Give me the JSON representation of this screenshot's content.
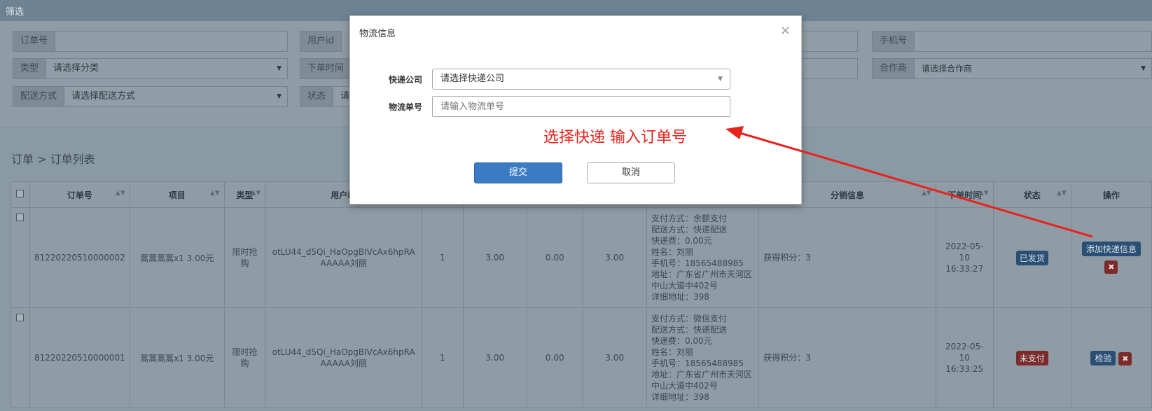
{
  "filter": {
    "title": "筛选",
    "order_no_label": "订单号",
    "user_id_label": "用户id",
    "phone_label": "手机号",
    "type_label": "类型",
    "type_value": "请选择分类",
    "order_time_label": "下单时间",
    "partner_label": "合作商",
    "partner_value": "请选择合作商",
    "delivery_label": "配送方式",
    "delivery_value": "请选择配送方式",
    "status_label": "状态",
    "status_value": "请"
  },
  "breadcrumb": "订单 > 订单列表",
  "table": {
    "headers": [
      "订单号",
      "项目",
      "类型",
      "用户id",
      "分销信息",
      "下单时间",
      "状态",
      "操作"
    ],
    "rows": [
      {
        "order_no": "81220220510000002",
        "item": "蒿蒿蒿蒿x1 3.00元",
        "type": "限时抢购",
        "user_id": "otLU44_d5Qi_HaOpgBIVcAx6hpRAAAAAA刘丽",
        "qty": "1",
        "price": "3.00",
        "discount": "0.00",
        "total": "3.00",
        "info": [
          "支付方式：余额支付",
          "配送方式：快递配送",
          "快递费：0.00元",
          "姓名：刘丽",
          "手机号：18565488985",
          "地址：广东省广州市天河区中山大道中402号",
          "详细地址：398"
        ],
        "dist": "获得积分：3",
        "time": "2022-05-10 16:33:27",
        "status": "已发货",
        "action": "添加快递信息"
      },
      {
        "order_no": "81220220510000001",
        "item": "蒿蒿蒿蒿x1 3.00元",
        "type": "限时抢购",
        "user_id": "otLU44_d5Qi_HaOpgBIVcAx6hpRAAAAAA刘丽",
        "qty": "1",
        "price": "3.00",
        "discount": "0.00",
        "total": "3.00",
        "info": [
          "支付方式：微信支付",
          "配送方式：快递配送",
          "快递费：0.00元",
          "姓名：刘丽",
          "手机号：18565488985",
          "地址：广东省广州市天河区中山大道中402号",
          "详细地址：398"
        ],
        "dist": "获得积分：3",
        "time": "2022-05-10 16:33:25",
        "status": "未支付",
        "action": "检验"
      }
    ]
  },
  "modal": {
    "title": "物流信息",
    "close": "×",
    "company_label": "快递公司",
    "company_value": "请选择快递公司",
    "tracking_label": "物流单号",
    "tracking_placeholder": "请输入物流单号",
    "annotation": "选择快递 输入订单号",
    "submit": "提交",
    "cancel": "取消"
  },
  "icons": {
    "close": "close-icon",
    "dropdown": "chevron-down-icon",
    "sort": "sort-icon",
    "delete": "delete-icon"
  },
  "colors": {
    "annotation": "#e8231b",
    "primary": "#3a7bc3"
  }
}
